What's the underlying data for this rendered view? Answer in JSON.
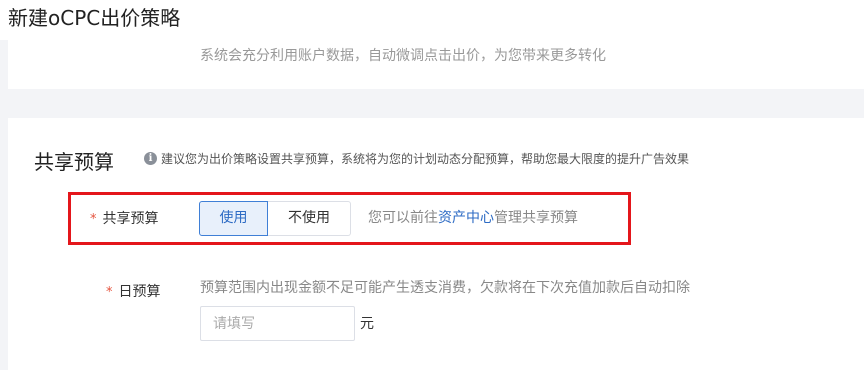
{
  "page": {
    "title": "新建oCPC出价策略"
  },
  "top_card": {
    "description": "系统会充分利用账户数据，自动微调点击出价，为您带来更多转化"
  },
  "shared_budget_section": {
    "title": "共享预算",
    "hint_icon": "info-icon",
    "hint": "建议您为出价策略设置共享预算，系统将为您的计划动态分配预算，帮助您最大限度的提升广告效果",
    "field": {
      "required_mark": "*",
      "label": "共享预算",
      "options": [
        "使用",
        "不使用"
      ],
      "selected": "使用",
      "tip_prefix": "您可以前往",
      "tip_link": "资产中心",
      "tip_suffix": "管理共享预算"
    },
    "highlight_color": "#e4161b"
  },
  "daily_budget": {
    "required_mark": "*",
    "label": "日预算",
    "description": "预算范围内出现金额不足可能产生透支消费，欠款将在下次充值加款后自动扣除",
    "input_value": "",
    "input_placeholder": "请填写",
    "unit": "元"
  },
  "colors": {
    "accent": "#2d6bc4",
    "required": "#e5533d",
    "page_bg": "#f3f4f7"
  }
}
